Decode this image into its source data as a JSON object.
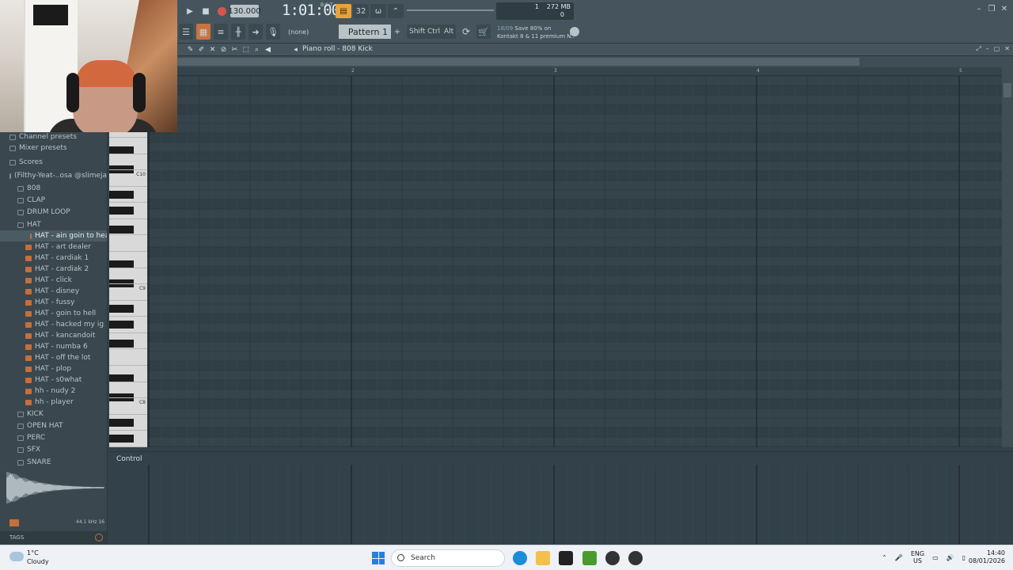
{
  "transport": {
    "tempo": "130.000",
    "time": "1:01:00",
    "time_sig": "B:S:T",
    "steps_label": "32",
    "cpu_top": "1",
    "mem": "272 MB",
    "cpu_bottom": "0"
  },
  "row2": {
    "none_label": "(none)",
    "pattern": "Pattern 1",
    "shift": "Shift",
    "ctrl": "Ctrl",
    "alt": "Alt",
    "news_date": "18/09",
    "news_line1": "Save 80% on",
    "news_line2": "Kontakt 8 & 11 premium N.."
  },
  "piano_roll": {
    "title": "Piano roll - 808 Kick",
    "bars": [
      "2",
      "3",
      "4",
      "5"
    ],
    "key_labels": [
      "C10",
      "C9",
      "C8"
    ],
    "control_label": "Control"
  },
  "browser": {
    "items": [
      {
        "label": "Channel presets",
        "type": "root"
      },
      {
        "label": "Mixer presets",
        "type": "root"
      },
      {
        "label": "Scores",
        "type": "root"
      },
      {
        "label": "(Filthy-Yeat-..osa @slimejax",
        "type": "folder-open"
      },
      {
        "label": "808",
        "type": "folder"
      },
      {
        "label": "CLAP",
        "type": "folder"
      },
      {
        "label": "DRUM LOOP",
        "type": "folder"
      },
      {
        "label": "HAT",
        "type": "folder-open"
      },
      {
        "label": "HAT - ain goin to heaven",
        "type": "file",
        "selected": true
      },
      {
        "label": "HAT - art dealer",
        "type": "file"
      },
      {
        "label": "HAT - cardiak 1",
        "type": "file"
      },
      {
        "label": "HAT - cardiak 2",
        "type": "file"
      },
      {
        "label": "HAT - click",
        "type": "file"
      },
      {
        "label": "HAT - disney",
        "type": "file"
      },
      {
        "label": "HAT - fussy",
        "type": "file"
      },
      {
        "label": "HAT - goin to hell",
        "type": "file"
      },
      {
        "label": "HAT - hacked my ig",
        "type": "file"
      },
      {
        "label": "HAT - kancandoit",
        "type": "file"
      },
      {
        "label": "HAT - numba 6",
        "type": "file"
      },
      {
        "label": "HAT - off the lot",
        "type": "file"
      },
      {
        "label": "HAT - plop",
        "type": "file"
      },
      {
        "label": "HAT - s0what",
        "type": "file"
      },
      {
        "label": "hh - nudy 2",
        "type": "file"
      },
      {
        "label": "hh - player",
        "type": "file"
      },
      {
        "label": "KICK",
        "type": "folder"
      },
      {
        "label": "OPEN HAT",
        "type": "folder"
      },
      {
        "label": "PERC",
        "type": "folder"
      },
      {
        "label": "SFX",
        "type": "folder"
      },
      {
        "label": "SNARE",
        "type": "folder"
      }
    ],
    "sample_info": "44.1 kHz 16",
    "tags": "TAGS"
  },
  "taskbar": {
    "temp": "1°C",
    "condition": "Cloudy",
    "search": "Search",
    "lang1": "ENG",
    "lang2": "US",
    "time": "14:40",
    "date": "08/01/2026"
  }
}
